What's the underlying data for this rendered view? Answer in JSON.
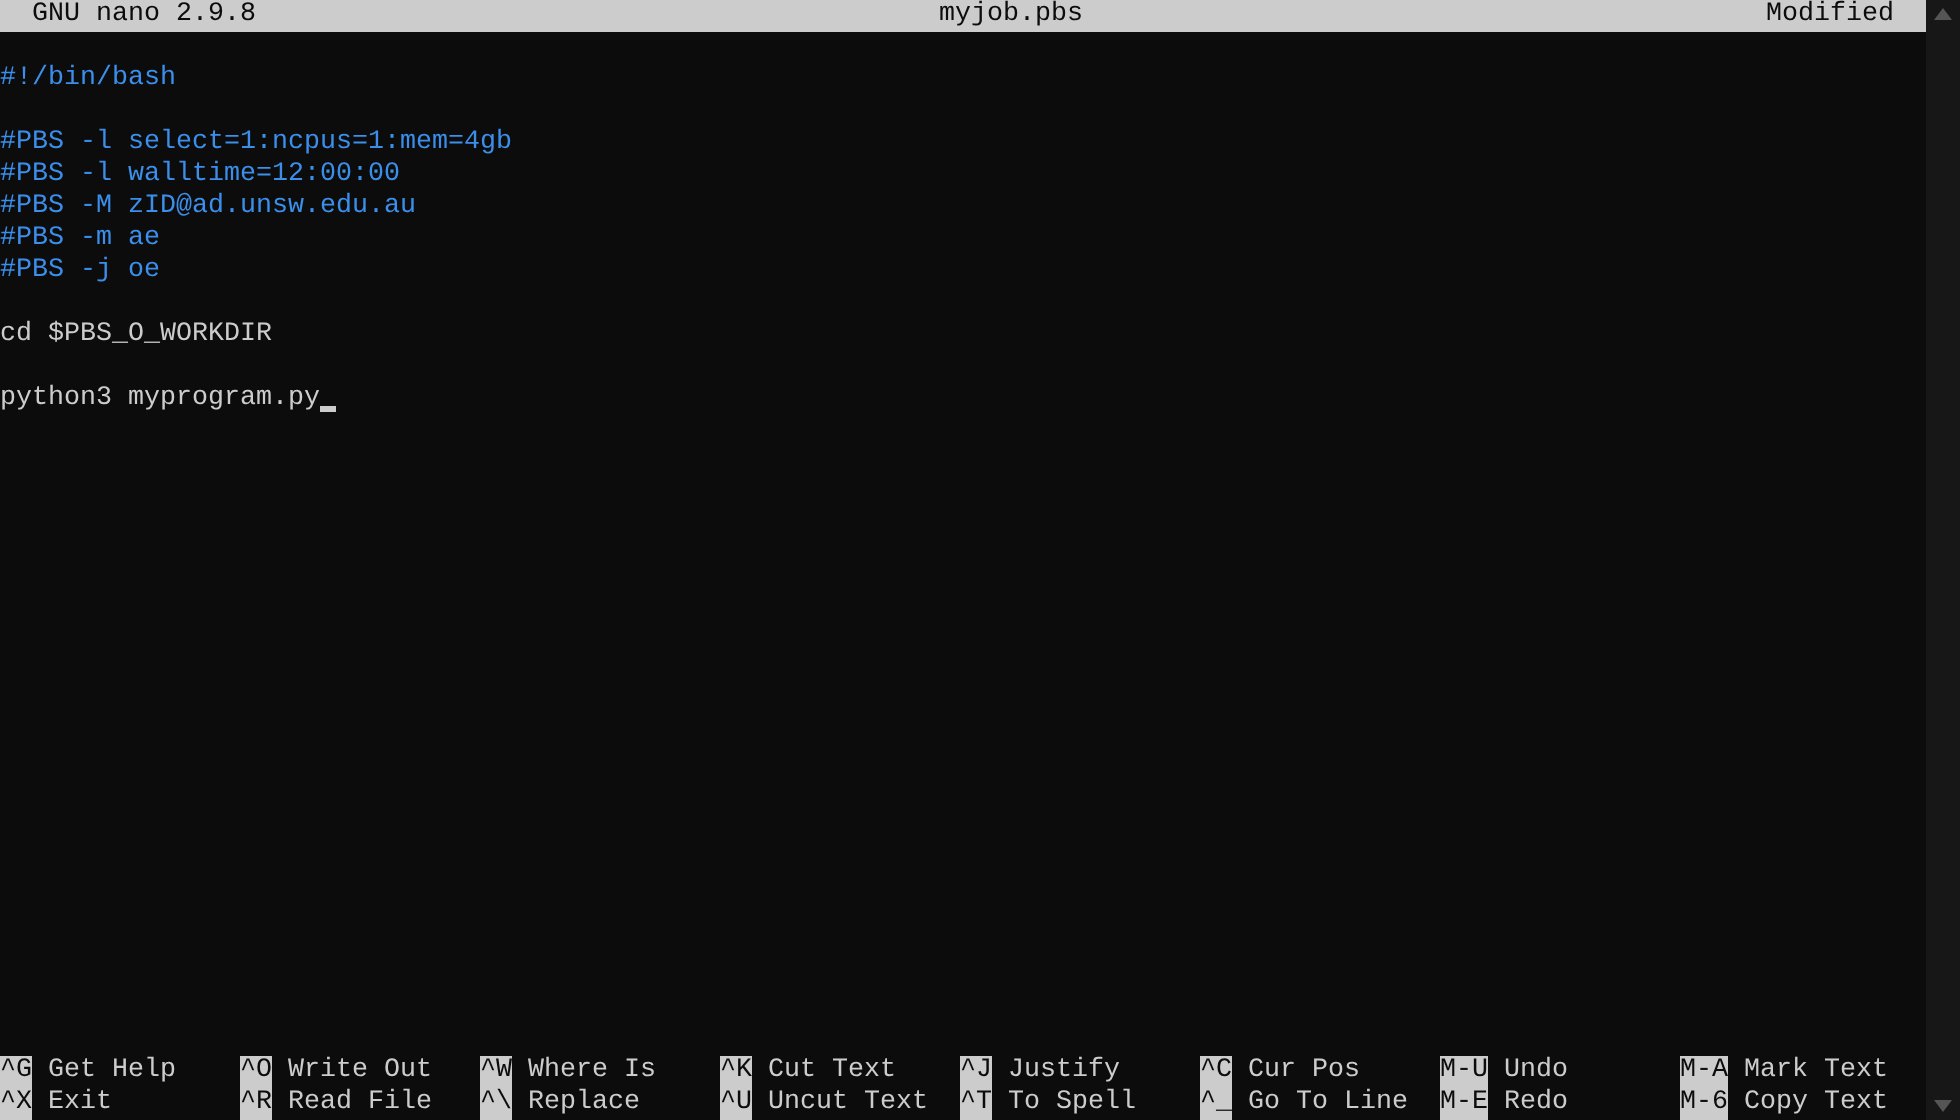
{
  "title_bar": {
    "version": "GNU nano 2.9.8",
    "filename": "myjob.pbs",
    "status": "Modified"
  },
  "lines": [
    {
      "kind": "blank"
    },
    {
      "kind": "comment",
      "text": "#!/bin/bash"
    },
    {
      "kind": "blank"
    },
    {
      "kind": "directive",
      "text": "#PBS -l select=1:ncpus=1:mem=4gb"
    },
    {
      "kind": "directive",
      "text": "#PBS -l walltime=12:00:00"
    },
    {
      "kind": "directive",
      "text": "#PBS -M zID@ad.unsw.edu.au"
    },
    {
      "kind": "directive",
      "text": "#PBS -m ae"
    },
    {
      "kind": "directive",
      "text": "#PBS -j oe"
    },
    {
      "kind": "blank"
    },
    {
      "kind": "command",
      "text": "cd $PBS_O_WORKDIR"
    },
    {
      "kind": "blank"
    },
    {
      "kind": "command",
      "text": "python3 myprogram.py",
      "cursor": true
    }
  ],
  "shortcuts": [
    [
      {
        "key": "^G",
        "label": "Get Help"
      },
      {
        "key": "^O",
        "label": "Write Out"
      },
      {
        "key": "^W",
        "label": "Where Is"
      },
      {
        "key": "^K",
        "label": "Cut Text"
      },
      {
        "key": "^J",
        "label": "Justify"
      },
      {
        "key": "^C",
        "label": "Cur Pos"
      },
      {
        "key": "M-U",
        "label": "Undo"
      },
      {
        "key": "M-A",
        "label": "Mark Text"
      }
    ],
    [
      {
        "key": "^X",
        "label": "Exit"
      },
      {
        "key": "^R",
        "label": "Read File"
      },
      {
        "key": "^\\",
        "label": "Replace"
      },
      {
        "key": "^U",
        "label": "Uncut Text"
      },
      {
        "key": "^T",
        "label": "To Spell"
      },
      {
        "key": "^_",
        "label": "Go To Line"
      },
      {
        "key": "M-E",
        "label": "Redo"
      },
      {
        "key": "M-6",
        "label": "Copy Text"
      }
    ]
  ]
}
